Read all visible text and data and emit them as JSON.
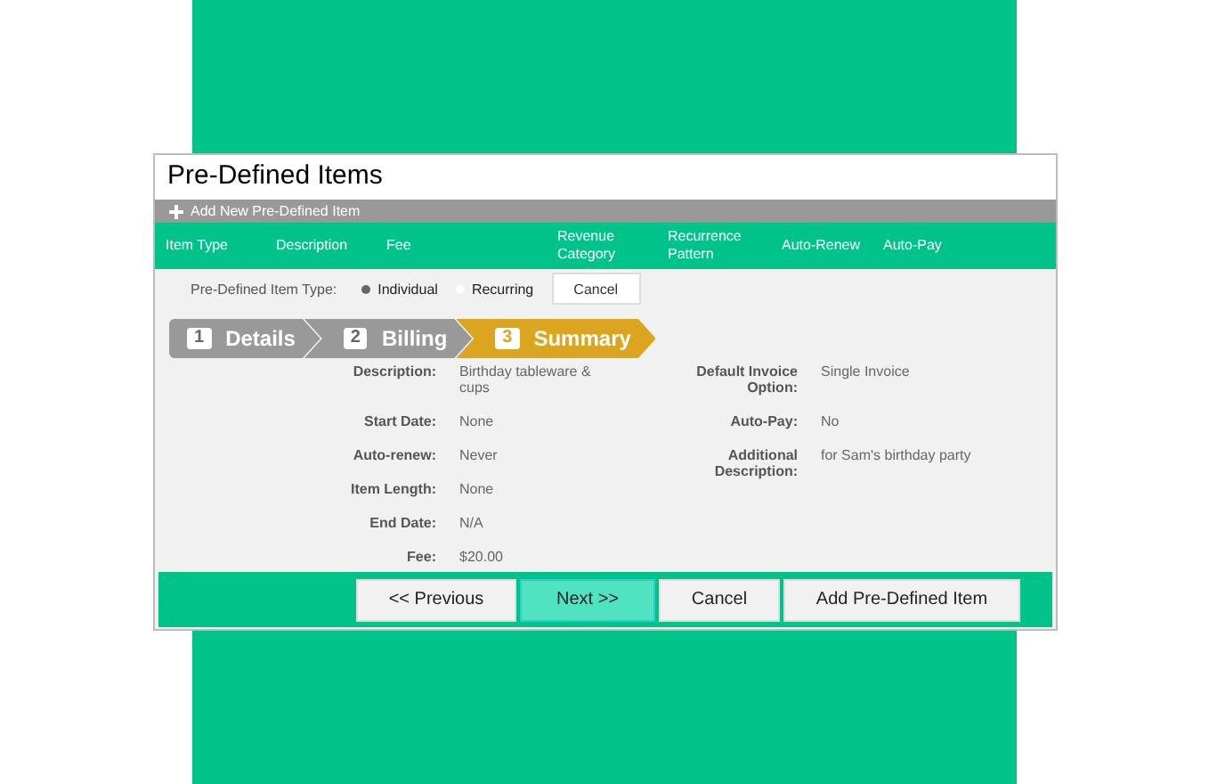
{
  "window": {
    "title": "Pre-Defined Items"
  },
  "add_bar": {
    "label": "Add New Pre-Defined Item"
  },
  "columns": [
    "Item Type",
    "Description",
    "Fee",
    "Revenue Category",
    "Recurrence Pattern",
    "Auto-Renew",
    "Auto-Pay"
  ],
  "item_type": {
    "label": "Pre-Defined Item Type:",
    "options": [
      {
        "label": "Individual",
        "selected": true
      },
      {
        "label": "Recurring",
        "selected": false
      }
    ],
    "cancel": "Cancel"
  },
  "steps": [
    {
      "number": "1",
      "label": "Details",
      "selected": false
    },
    {
      "number": "2",
      "label": "Billing",
      "selected": false
    },
    {
      "number": "3",
      "label": "Summary",
      "selected": true
    }
  ],
  "summary_left": [
    {
      "label": "Description:",
      "value": "Birthday tableware & cups"
    },
    {
      "label": "Start Date:",
      "value": "None"
    },
    {
      "label": "Auto-renew:",
      "value": "Never"
    },
    {
      "label": "Item Length:",
      "value": "None"
    },
    {
      "label": "End Date:",
      "value": "N/A"
    },
    {
      "label": "Fee:",
      "value": "$20.00"
    }
  ],
  "summary_right": [
    {
      "label": "Default Invoice Option:",
      "value": "Single Invoice"
    },
    {
      "label": "Auto-Pay:",
      "value": "No"
    },
    {
      "label": "Additional Description:",
      "value": "for Sam's birthday party"
    }
  ],
  "buttons": [
    {
      "label": "<< Previous",
      "selected": false
    },
    {
      "label": "Next >>",
      "selected": true
    },
    {
      "label": "Cancel",
      "selected": false
    },
    {
      "label": "Add Pre-Defined Item",
      "selected": false
    }
  ]
}
